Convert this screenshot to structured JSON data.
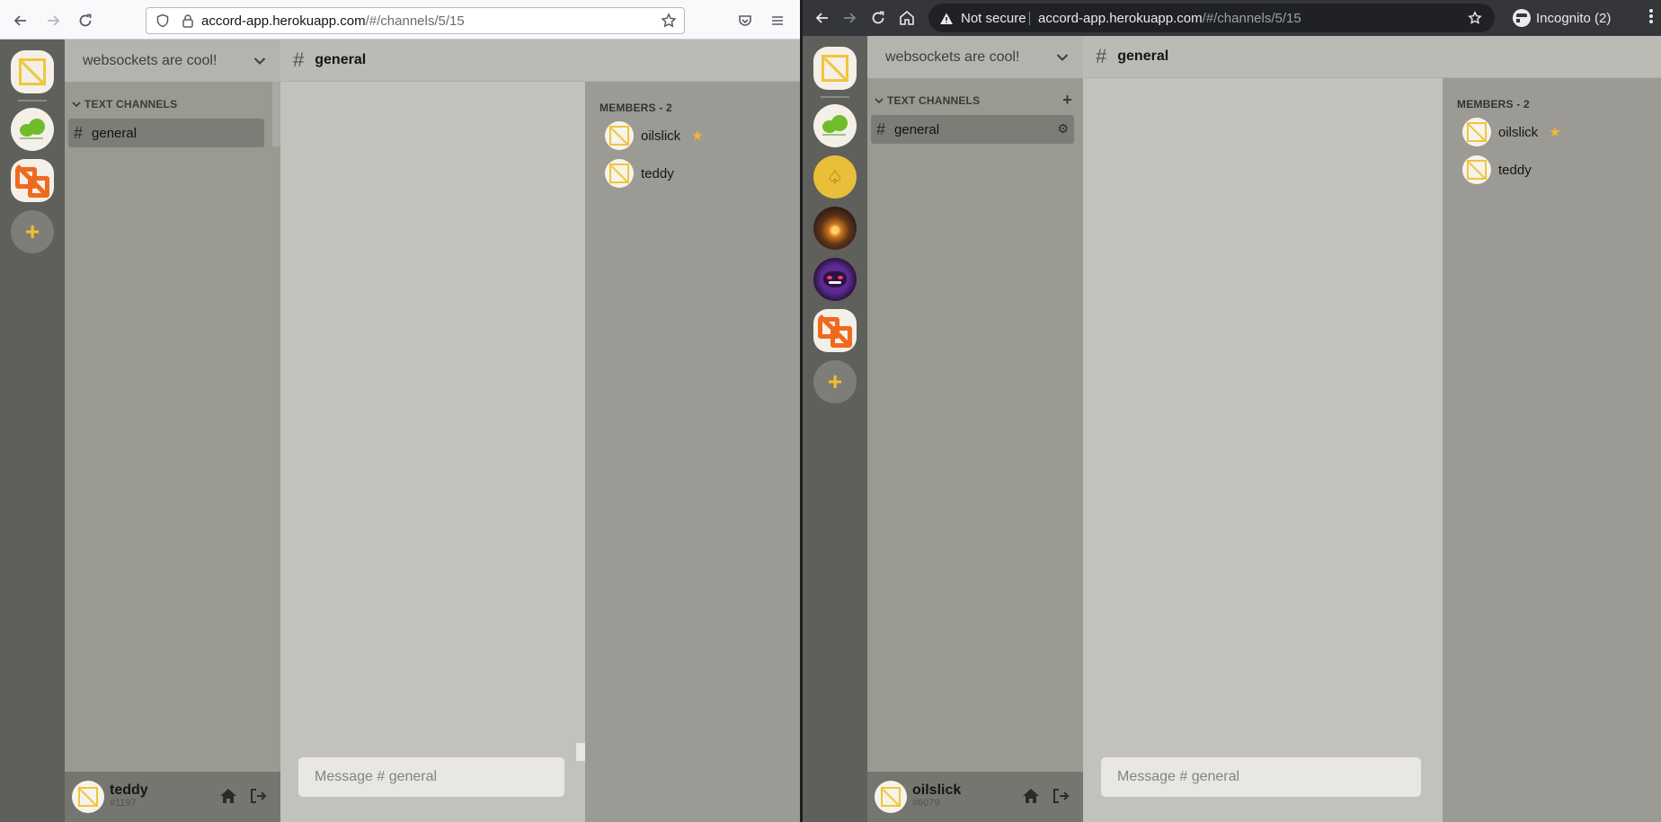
{
  "left_window": {
    "browser": {
      "url_host": "accord-app.herokuapp.com",
      "url_path": "/#/channels/5/15"
    },
    "app": {
      "server_name": "websockets are cool!",
      "category": "TEXT CHANNELS",
      "channel": "general",
      "header_channel": "general",
      "members_title": "MEMBERS - 2",
      "members": [
        {
          "name": "oilslick",
          "owner": true
        },
        {
          "name": "teddy",
          "owner": false
        }
      ],
      "message_placeholder": "Message # general",
      "user": {
        "name": "teddy",
        "tag": "#1197"
      }
    }
  },
  "right_window": {
    "browser": {
      "security_label": "Not secure",
      "url_host": "accord-app.herokuapp.com",
      "url_path": "/#/channels/5/15",
      "incognito_label": "Incognito (2)"
    },
    "app": {
      "server_name": "websockets are cool!",
      "category": "TEXT CHANNELS",
      "channel": "general",
      "header_channel": "general",
      "members_title": "MEMBERS - 2",
      "members": [
        {
          "name": "oilslick",
          "owner": true
        },
        {
          "name": "teddy",
          "owner": false
        }
      ],
      "message_placeholder": "Message # general",
      "user": {
        "name": "oilslick",
        "tag": "#6079"
      }
    }
  },
  "icons": {
    "back": "arrow-left-icon",
    "forward": "arrow-right-icon",
    "reload": "reload-icon",
    "home": "home-icon",
    "logout": "logout-icon",
    "add_server": "plus-icon",
    "owner": "star-icon"
  },
  "colors": {
    "accent_yellow": "#f0c53d",
    "server_rail": "#5f5f5b",
    "channels_bg": "#9a9a93",
    "chat_bg": "#c3c1bb",
    "members_bg": "#9c9a94",
    "orange_logo": "#ef6a1f"
  }
}
